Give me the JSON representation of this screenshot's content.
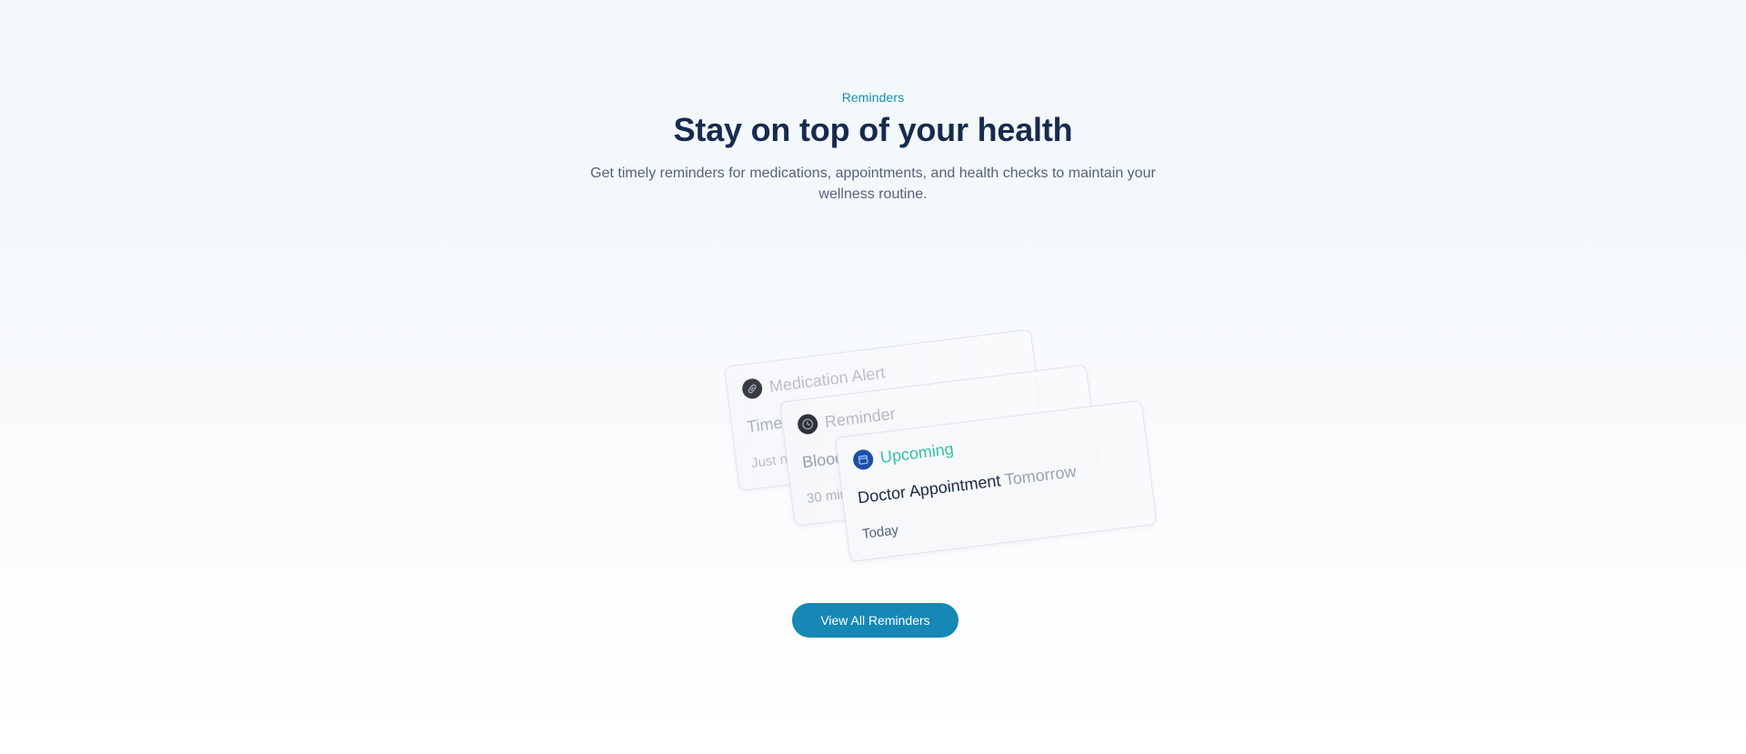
{
  "section": {
    "eyebrow": "Reminders",
    "title": "Stay on top of your health",
    "subtitle": "Get timely reminders for medications, appointments, and health checks to maintain your wellness routine."
  },
  "cards": [
    {
      "icon": "pill-icon",
      "label": "Medication Alert",
      "body": "Time",
      "time": "Just n"
    },
    {
      "icon": "clock-icon",
      "label": "Reminder",
      "body": "Blood",
      "time": "30 mir"
    },
    {
      "icon": "calendar-icon",
      "label": "Upcoming",
      "body": "Doctor Appointment ",
      "body_fade": "Tomorrow",
      "time": "Today",
      "accent": "#35c2a6",
      "icon_color": "#1d4fa8"
    }
  ],
  "cta": {
    "label": "View All Reminders",
    "color": "#1588b5"
  },
  "colors": {
    "eyebrow": "#1a8ab5",
    "title": "#172a4f",
    "text": "#56627a"
  }
}
